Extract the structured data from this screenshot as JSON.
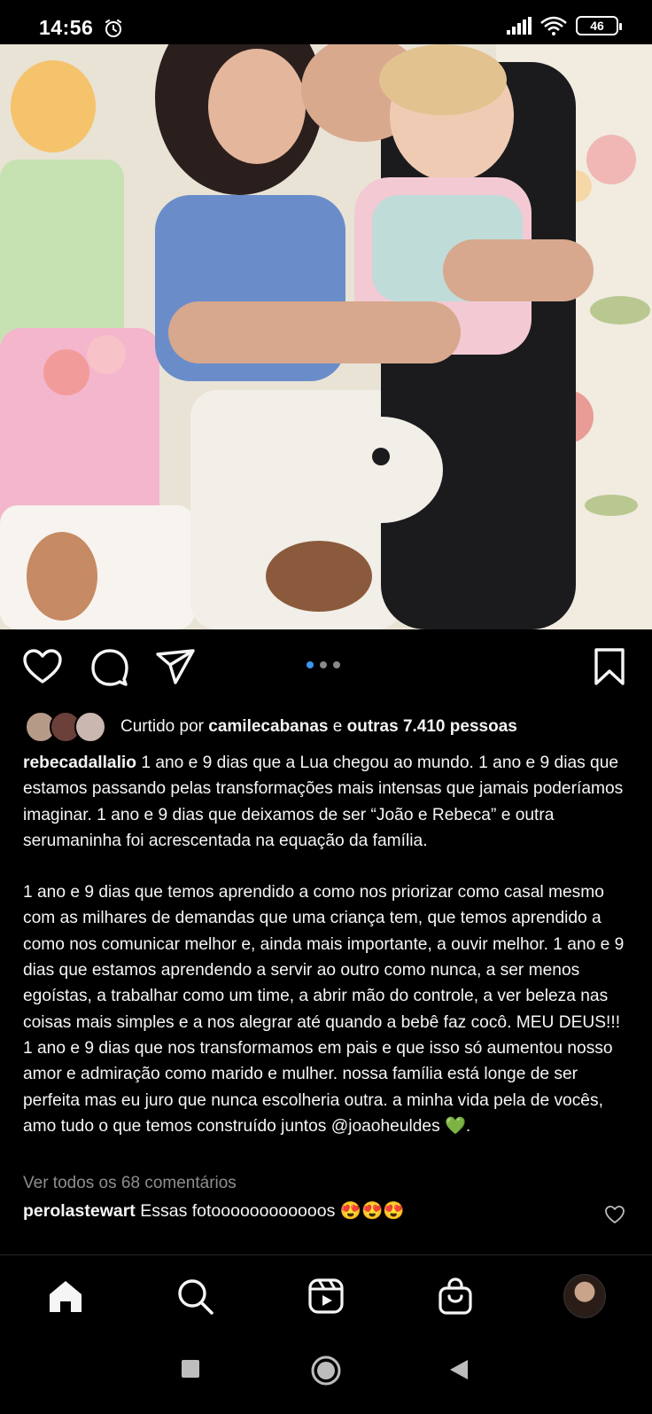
{
  "status_bar": {
    "time": "14:56",
    "battery": "46"
  },
  "post": {
    "carousel": {
      "count": 3,
      "active_index": 0
    },
    "likes": {
      "prefix": "Curtido por ",
      "user": "camilecabanas",
      "connector": " e ",
      "others": "outras 7.410 pessoas"
    },
    "caption": {
      "username": "rebecadallalio",
      "paragraph1": " 1 ano e 9 dias que a Lua chegou ao mundo. 1 ano e 9 dias que estamos passando pelas transformações mais intensas que jamais poderíamos imaginar. 1 ano e 9 dias que deixamos de ser “João e Rebeca” e outra serumaninha foi acrescentada na equação da família.",
      "paragraph2": "1 ano e 9 dias que temos aprendido a como nos priorizar como casal mesmo com as milhares de demandas que uma criança tem, que temos aprendido a como nos comunicar melhor e, ainda mais importante, a ouvir melhor. 1 ano e 9 dias que estamos aprendendo a servir ao outro como nunca, a ser menos egoístas, a trabalhar como um time, a abrir mão do controle, a ver beleza nas coisas mais simples e a nos alegrar até quando a bebê faz cocô. MEU DEUS!!! 1 ano e 9 dias que nos transformamos em pais e que isso só aumentou nosso amor e admiração como marido e mulher. nossa família está longe de ser perfeita mas eu juro que nunca escolheria outra. a minha vida pela de vocês, amo tudo o que temos construído juntos @joaoheuldes 💚."
    },
    "view_comments": "Ver todos os 68 comentários",
    "top_comment": {
      "username": "perolastewart",
      "text": " Essas fotoooooooooooos 😍😍😍"
    }
  },
  "icons": {
    "like": "heart-icon",
    "comment": "comment-icon",
    "share": "send-icon",
    "save": "bookmark-icon",
    "nav": [
      "home-icon",
      "search-icon",
      "reels-icon",
      "shop-icon",
      "profile-avatar"
    ]
  },
  "colors": {
    "background": "#000000",
    "text": "#f5f5f5",
    "muted": "#8e8e8e",
    "accent": "#3897f0"
  }
}
